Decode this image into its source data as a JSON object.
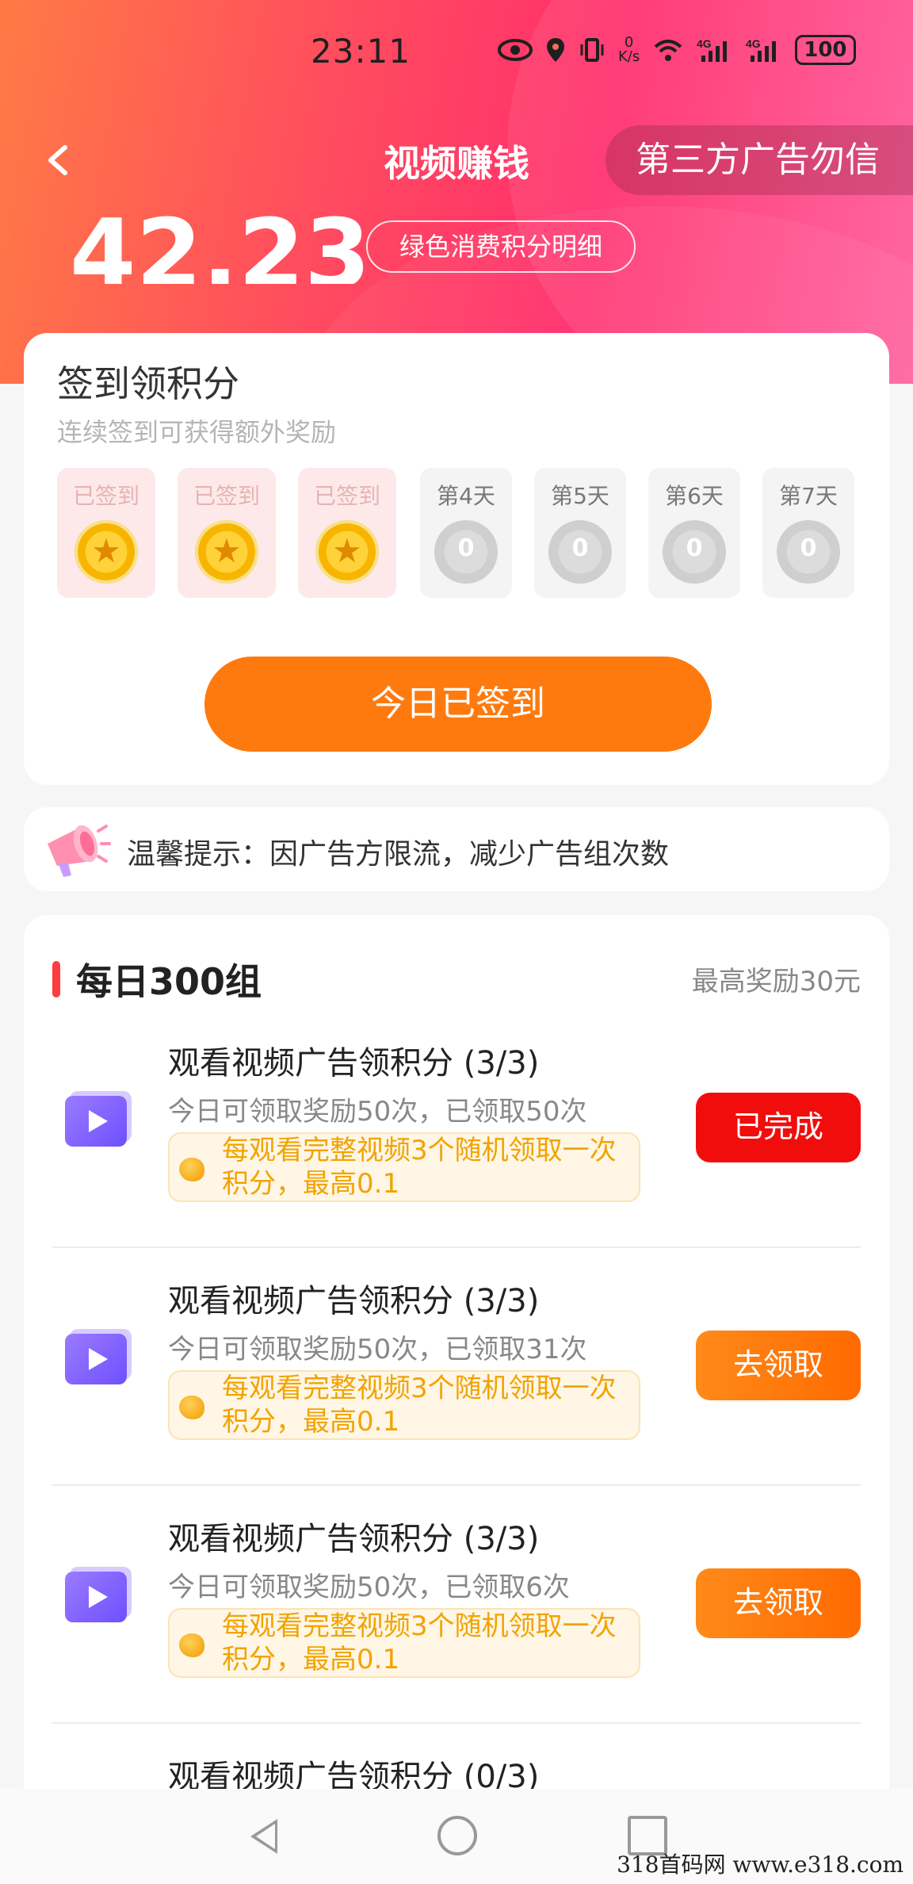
{
  "status_bar": {
    "time": "23:11",
    "net_speed_value": "0",
    "net_speed_unit": "K/s",
    "battery": "100"
  },
  "nav": {
    "title": "视频赚钱",
    "ad_warning": "第三方广告勿信"
  },
  "summary": {
    "score": "42.23",
    "detail_link": "绿色消费积分明细"
  },
  "checkin": {
    "title": "签到领积分",
    "subtitle": "连续签到可获得额外奖励",
    "days": [
      {
        "label": "已签到",
        "signed": true
      },
      {
        "label": "已签到",
        "signed": true
      },
      {
        "label": "已签到",
        "signed": true
      },
      {
        "label": "第4天",
        "signed": false,
        "coin": "0"
      },
      {
        "label": "第5天",
        "signed": false,
        "coin": "0"
      },
      {
        "label": "第6天",
        "signed": false,
        "coin": "0"
      },
      {
        "label": "第7天",
        "signed": false,
        "coin": "0"
      }
    ],
    "button_label": "今日已签到"
  },
  "tip": {
    "text": "温馨提示：因广告方限流，减少广告组次数"
  },
  "tasks": {
    "heading": "每日300组",
    "max_reward": "最高奖励30元",
    "items": [
      {
        "name": "观看视频广告领积分 (3/3)",
        "count": "今日可领取奖励50次，已领取50次",
        "note": "每观看完整视频3个随机领取一次积分，最高0.1",
        "button": "已完成",
        "state": "done"
      },
      {
        "name": "观看视频广告领积分 (3/3)",
        "count": "今日可领取奖励50次，已领取31次",
        "note": "每观看完整视频3个随机领取一次积分，最高0.1",
        "button": "去领取",
        "state": "go"
      },
      {
        "name": "观看视频广告领积分 (3/3)",
        "count": "今日可领取奖励50次，已领取6次",
        "note": "每观看完整视频3个随机领取一次积分，最高0.1",
        "button": "去领取",
        "state": "go"
      },
      {
        "name": "观看视频广告领积分 (0/3)"
      }
    ]
  },
  "watermark": "318首码网  www.e318.com",
  "colors": {
    "accent_orange": "#ff7a0e",
    "done_red": "#f20d0d",
    "hero_pink": "#ff2d6d"
  }
}
